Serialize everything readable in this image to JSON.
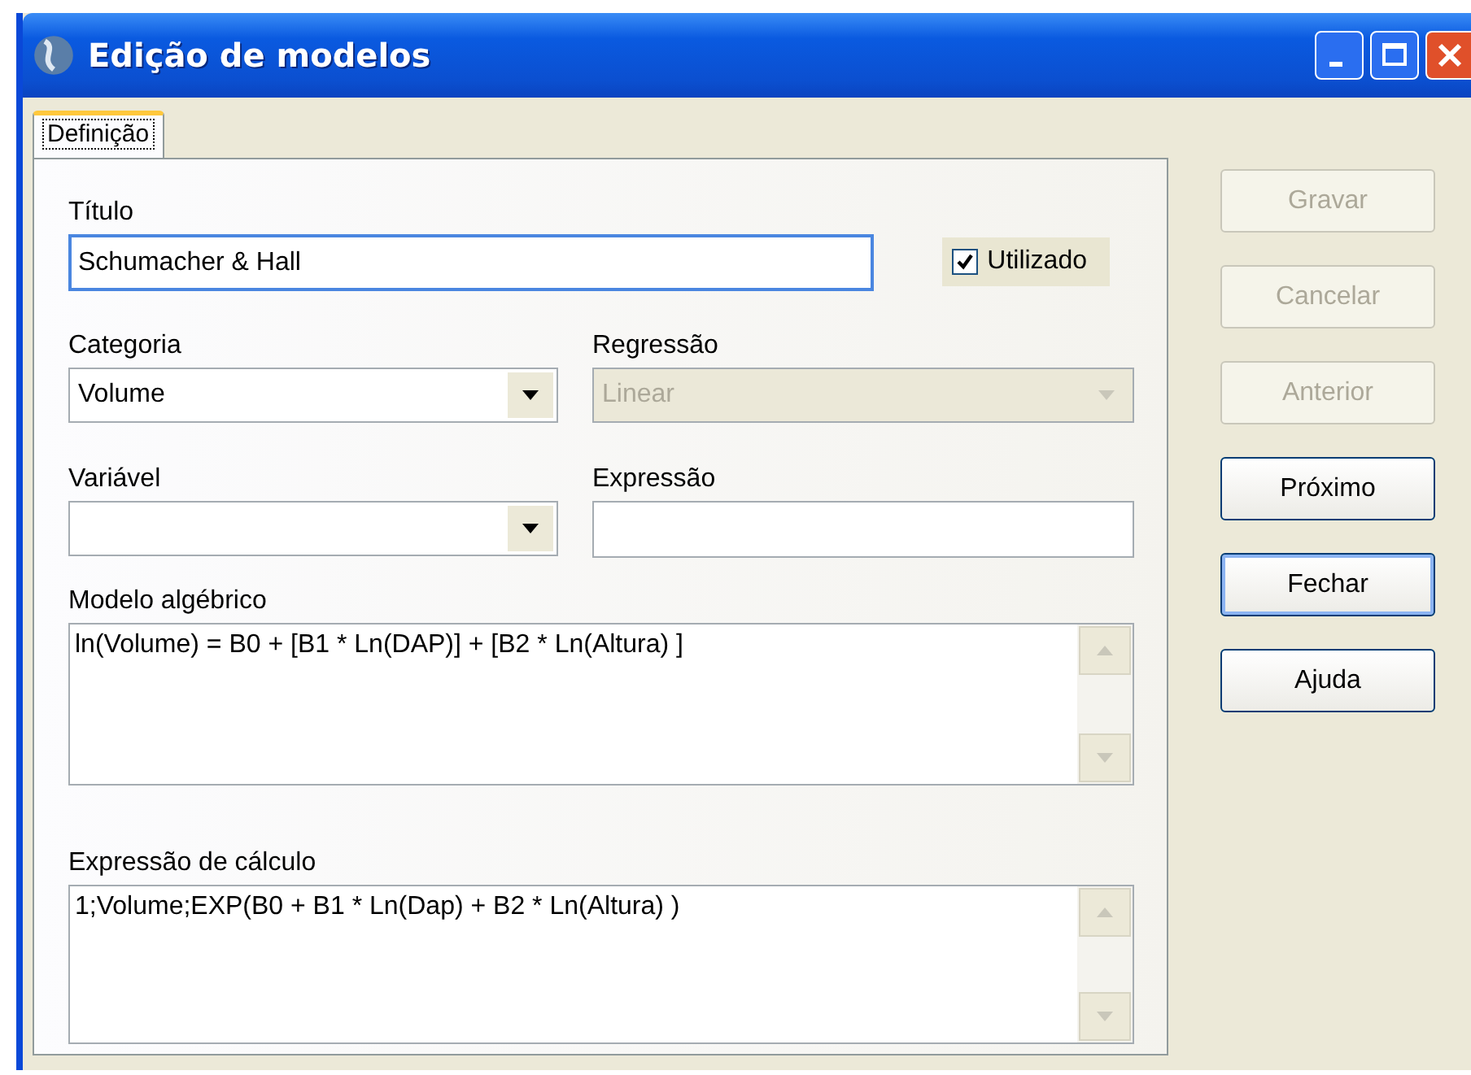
{
  "window": {
    "title": "Edição de modelos"
  },
  "tabs": [
    {
      "label": "Definição",
      "selected": true
    }
  ],
  "fields": [
    {
      "kind": "text",
      "label": "Título",
      "value": "Schumacher & Hall",
      "focused": true
    },
    {
      "kind": "checkbox",
      "label": "Utilizado",
      "checked": true
    },
    {
      "kind": "combo",
      "label": "Categoria",
      "value": "Volume",
      "disabled": false
    },
    {
      "kind": "combo",
      "label": "Regressão",
      "value": "Linear",
      "disabled": true
    },
    {
      "kind": "combo",
      "label": "Variável",
      "disabled": false
    },
    {
      "kind": "text",
      "label": "Expressão",
      "focused": false
    },
    {
      "kind": "memo",
      "label": "Modelo algébrico",
      "value": "ln(Volume) = B0 + [B1 * Ln(DAP)] + [B2 * Ln(Altura) ]"
    },
    {
      "kind": "memo",
      "label": "Expressão de cálculo",
      "value": "1;Volume;EXP(B0 + B1 * Ln(Dap) + B2 * Ln(Altura)  )"
    }
  ],
  "buttons": [
    {
      "label": "Gravar",
      "disabled": true,
      "default": false
    },
    {
      "label": "Cancelar",
      "disabled": true,
      "default": false
    },
    {
      "label": "Anterior",
      "disabled": true,
      "default": false
    },
    {
      "label": "Próximo",
      "disabled": false,
      "default": false
    },
    {
      "label": "Fechar",
      "disabled": false,
      "default": true
    },
    {
      "label": "Ajuda",
      "disabled": false,
      "default": false
    }
  ]
}
